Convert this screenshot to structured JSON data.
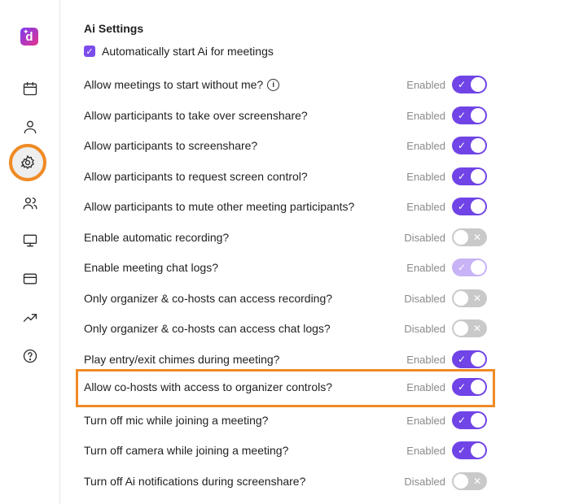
{
  "sidebar": {
    "logo_text": "d",
    "items": [
      {
        "name": "calendar-icon"
      },
      {
        "name": "user-icon"
      },
      {
        "name": "gear-icon"
      },
      {
        "name": "users-icon"
      },
      {
        "name": "monitor-icon"
      },
      {
        "name": "card-icon"
      },
      {
        "name": "trending-icon"
      },
      {
        "name": "help-icon"
      }
    ]
  },
  "section": {
    "title": "Ai Settings",
    "auto_start_label": "Automatically start Ai for meetings",
    "auto_start_checked": true
  },
  "settings": [
    {
      "label": "Allow meetings to start without me?",
      "status": "Enabled",
      "on": true
    },
    {
      "label": "Allow participants to take over screenshare?",
      "status": "Enabled",
      "on": true
    },
    {
      "label": "Allow participants to screenshare?",
      "status": "Enabled",
      "on": true
    },
    {
      "label": "Allow participants to request screen control?",
      "status": "Enabled",
      "on": true
    },
    {
      "label": "Allow participants to mute other meeting participants?",
      "status": "Enabled",
      "on": true
    },
    {
      "label": "Enable automatic recording?",
      "status": "Disabled",
      "on": false
    },
    {
      "label": "Enable meeting chat logs?",
      "status": "Enabled",
      "on": true
    },
    {
      "label": "Only organizer & co-hosts can access recording?",
      "status": "Disabled",
      "on": false
    },
    {
      "label": "Only organizer & co-hosts can access chat logs?",
      "status": "Disabled",
      "on": false
    },
    {
      "label": "Play entry/exit chimes during meeting?",
      "status": "Enabled",
      "on": true
    },
    {
      "label": "Allow co-hosts with access to organizer controls?",
      "status": "Enabled",
      "on": true
    },
    {
      "label": "Turn off mic while joining a meeting?",
      "status": "Enabled",
      "on": true
    },
    {
      "label": "Turn off camera while joining a meeting?",
      "status": "Enabled",
      "on": true
    },
    {
      "label": "Turn off Ai notifications during screenshare?",
      "status": "Disabled",
      "on": false
    }
  ],
  "icons": {
    "check": "✓",
    "cross": "✕",
    "info": "i"
  },
  "colors": {
    "accent": "#7044e6",
    "highlight": "#f08a24",
    "toggle_off": "#c9c9c9"
  }
}
